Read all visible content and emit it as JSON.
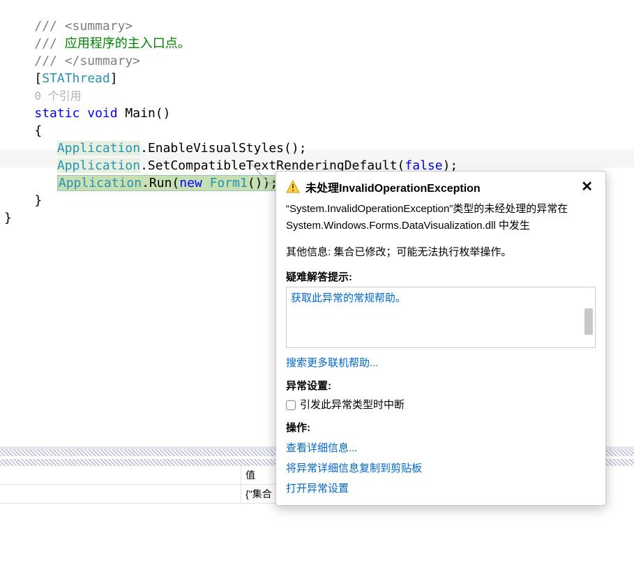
{
  "code": {
    "docline1_pre": "/// ",
    "docline1_main": "<summary>",
    "docline2_pre": "/// ",
    "docline2_main": "应用程序的主入口点。",
    "docline3_pre": "/// ",
    "docline3_main": "</summary>",
    "attr_open": "[",
    "attr_name": "STAThread",
    "attr_close": "]",
    "refcount": "0 个引用",
    "sig_static": "static",
    "sig_void": "void",
    "sig_main": " Main()",
    "brace_open": "{",
    "app": "Application",
    "dot": ".",
    "m1_rest": "EnableVisualStyles();",
    "m2_rest": "SetCompatibleTextRenderingDefault(",
    "m2_false": "false",
    "m2_close": ");",
    "m3_rest": "Run(",
    "m3_new": "new",
    "m3_form": " Form1",
    "m3_close": "());",
    "brace_close": "}",
    "outer_brace_close": "}"
  },
  "bottom": {
    "header_value": "值",
    "row_value": "{\"集合"
  },
  "exception": {
    "title": "未处理InvalidOperationException",
    "msg1": "“System.InvalidOperationException”类型的未经处理的异常在 System.Windows.Forms.DataVisualization.dll 中发生",
    "msg2": "其他信息: 集合已修改；可能无法执行枚举操作。",
    "troubleshoot_heading": "疑难解答提示:",
    "help_general": "获取此异常的常规帮助。",
    "search_more": "搜索更多联机帮助...",
    "settings_heading": "异常设置:",
    "break_on_type": "引发此异常类型时中断",
    "actions_heading": "操作:",
    "view_detail": "查看详细信息...",
    "copy_to_clip": "将异常详细信息复制到剪贴板",
    "open_settings": "打开异常设置"
  }
}
